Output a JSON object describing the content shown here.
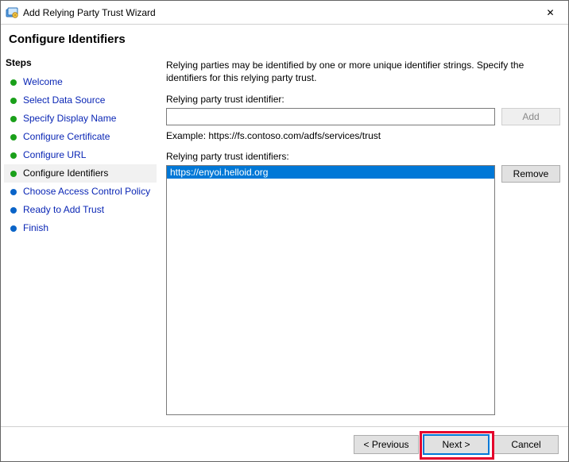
{
  "window": {
    "title": "Add Relying Party Trust Wizard",
    "close_glyph": "✕"
  },
  "page": {
    "header": "Configure Identifiers"
  },
  "sidebar": {
    "title": "Steps",
    "steps": [
      {
        "label": "Welcome",
        "status": "done"
      },
      {
        "label": "Select Data Source",
        "status": "done"
      },
      {
        "label": "Specify Display Name",
        "status": "done"
      },
      {
        "label": "Configure Certificate",
        "status": "done"
      },
      {
        "label": "Configure URL",
        "status": "done"
      },
      {
        "label": "Configure Identifiers",
        "status": "current"
      },
      {
        "label": "Choose Access Control Policy",
        "status": "todo"
      },
      {
        "label": "Ready to Add Trust",
        "status": "todo"
      },
      {
        "label": "Finish",
        "status": "todo"
      }
    ]
  },
  "main": {
    "intro": "Relying parties may be identified by one or more unique identifier strings. Specify the identifiers for this relying party trust.",
    "identifier_label": "Relying party trust identifier:",
    "identifier_value": "",
    "add_btn": "Add",
    "example": "Example: https://fs.contoso.com/adfs/services/trust",
    "list_label": "Relying party trust identifiers:",
    "identifiers": [
      {
        "value": "https://enyoi.helloid.org",
        "selected": true
      }
    ],
    "remove_btn": "Remove"
  },
  "footer": {
    "previous": "< Previous",
    "next": "Next >",
    "cancel": "Cancel"
  }
}
